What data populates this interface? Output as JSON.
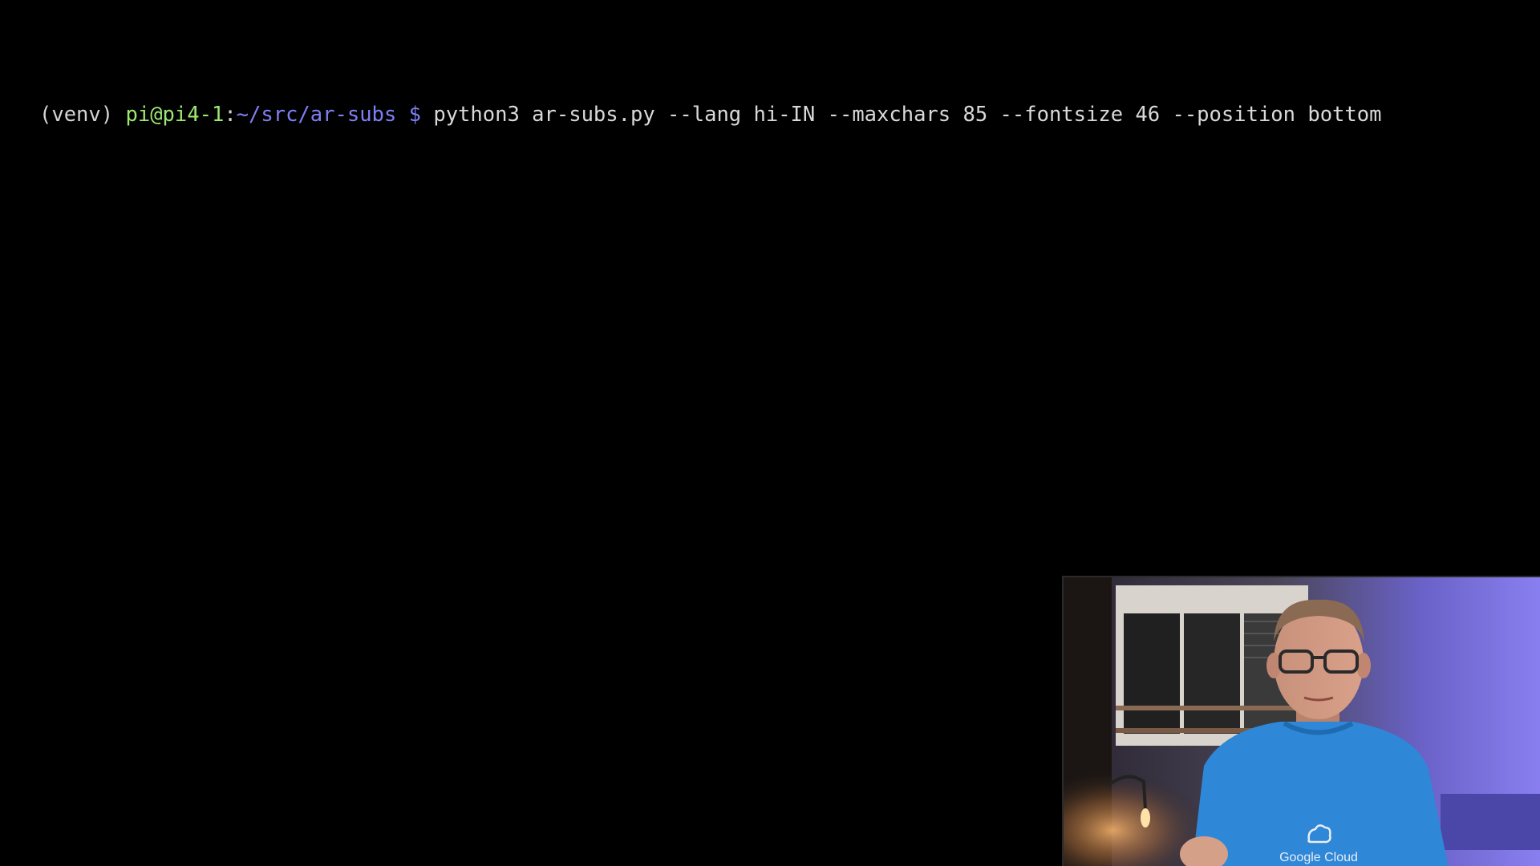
{
  "terminal": {
    "prompt": {
      "venv": "(venv)",
      "user_host": "pi@pi4-1",
      "separator": ":",
      "path": "~/src/ar-subs",
      "symbol": "$"
    },
    "command": "python3 ar-subs.py --lang hi-IN --maxchars 85 --fontsize 46 --position bottom"
  },
  "webcam": {
    "shirt_logo_text": "Google Cloud",
    "icon": "cloud-icon"
  },
  "colors": {
    "background": "#000000",
    "prompt_user": "#9ee870",
    "prompt_path": "#7f7ff4",
    "text": "#d9d9d9",
    "shirt": "#2f87d8",
    "wall_light": "#7a6fe0"
  }
}
